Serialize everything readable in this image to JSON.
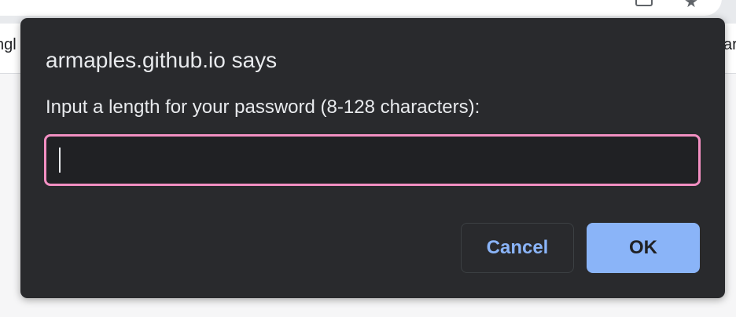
{
  "browser": {
    "bookmark_left_partial": "ngl",
    "bookmark_right_partial": "ar",
    "icons": [
      "tab-search-icon",
      "star-icon"
    ]
  },
  "dialog": {
    "title": "armaples.github.io says",
    "message": "Input a length for your password (8-128 characters):",
    "input_value": "",
    "input_placeholder": "",
    "cancel_label": "Cancel",
    "ok_label": "OK"
  },
  "colors": {
    "dialog_bg": "#292a2d",
    "input_border_focus": "#f28fc2",
    "primary_button": "#8ab4f8",
    "link_text": "#8ab4f8"
  }
}
